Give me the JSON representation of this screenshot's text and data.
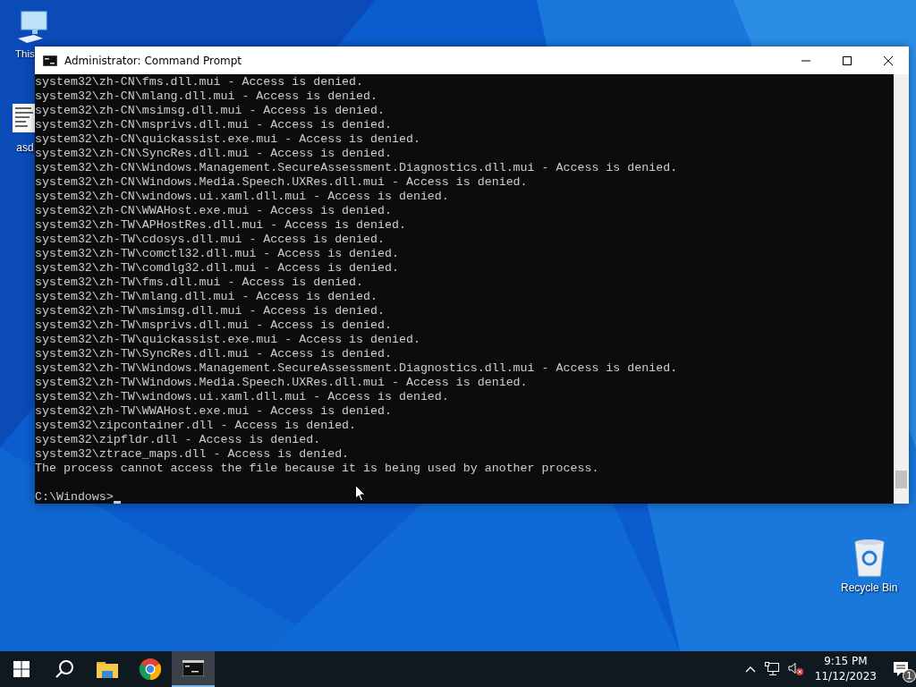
{
  "desktop_icons": [
    {
      "kind": "computer",
      "label": "This"
    },
    {
      "kind": "document",
      "label": "asd"
    },
    {
      "kind": "recycle-bin",
      "label": "Recycle Bin"
    }
  ],
  "window": {
    "title": "Administrator: Command Prompt"
  },
  "console": {
    "lines": [
      "system32\\zh-CN\\fms.dll.mui - Access is denied.",
      "system32\\zh-CN\\mlang.dll.mui - Access is denied.",
      "system32\\zh-CN\\msimsg.dll.mui - Access is denied.",
      "system32\\zh-CN\\msprivs.dll.mui - Access is denied.",
      "system32\\zh-CN\\quickassist.exe.mui - Access is denied.",
      "system32\\zh-CN\\SyncRes.dll.mui - Access is denied.",
      "system32\\zh-CN\\Windows.Management.SecureAssessment.Diagnostics.dll.mui - Access is denied.",
      "system32\\zh-CN\\Windows.Media.Speech.UXRes.dll.mui - Access is denied.",
      "system32\\zh-CN\\windows.ui.xaml.dll.mui - Access is denied.",
      "system32\\zh-CN\\WWAHost.exe.mui - Access is denied.",
      "system32\\zh-TW\\APHostRes.dll.mui - Access is denied.",
      "system32\\zh-TW\\cdosys.dll.mui - Access is denied.",
      "system32\\zh-TW\\comctl32.dll.mui - Access is denied.",
      "system32\\zh-TW\\comdlg32.dll.mui - Access is denied.",
      "system32\\zh-TW\\fms.dll.mui - Access is denied.",
      "system32\\zh-TW\\mlang.dll.mui - Access is denied.",
      "system32\\zh-TW\\msimsg.dll.mui - Access is denied.",
      "system32\\zh-TW\\msprivs.dll.mui - Access is denied.",
      "system32\\zh-TW\\quickassist.exe.mui - Access is denied.",
      "system32\\zh-TW\\SyncRes.dll.mui - Access is denied.",
      "system32\\zh-TW\\Windows.Management.SecureAssessment.Diagnostics.dll.mui - Access is denied.",
      "system32\\zh-TW\\Windows.Media.Speech.UXRes.dll.mui - Access is denied.",
      "system32\\zh-TW\\windows.ui.xaml.dll.mui - Access is denied.",
      "system32\\zh-TW\\WWAHost.exe.mui - Access is denied.",
      "system32\\zipcontainer.dll - Access is denied.",
      "system32\\zipfldr.dll - Access is denied.",
      "system32\\ztrace_maps.dll - Access is denied.",
      "The process cannot access the file because it is being used by another process."
    ],
    "prompt": "C:\\Windows>",
    "cursor": true
  },
  "taskbar": {
    "apps": [
      {
        "kind": "start",
        "selected": false
      },
      {
        "kind": "search",
        "selected": false
      },
      {
        "kind": "folder",
        "selected": false
      },
      {
        "kind": "browser",
        "selected": false
      },
      {
        "kind": "terminal",
        "selected": true
      }
    ],
    "time": "9:15 PM",
    "date": "11/12/2023",
    "notification_count": "1"
  }
}
